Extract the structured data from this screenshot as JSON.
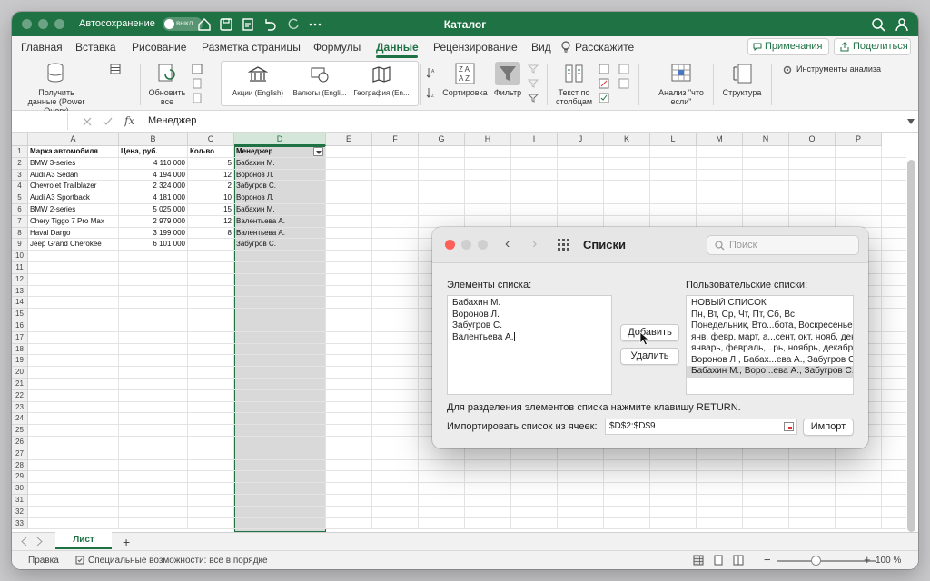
{
  "titlebar": {
    "autosave_label": "Автосохранение",
    "autosave_state": "выкл.",
    "document_title": "Каталог"
  },
  "ribbon_tabs": {
    "items": [
      "Главная",
      "Вставка",
      "Рисование",
      "Разметка страницы",
      "Формулы",
      "Данные",
      "Рецензирование",
      "Вид"
    ],
    "active": "Данные",
    "tell_me": "Расскажите",
    "notes_button": "Примечания",
    "share_button": "Поделиться"
  },
  "ribbon": {
    "get_data": [
      "Получить",
      "данные (Power Query)"
    ],
    "refresh_all": [
      "Обновить",
      "все"
    ],
    "data_types": [
      "Акции (English)",
      "Валюты (Engli...",
      "География (En..."
    ],
    "sort": "Сортировка",
    "filter": "Фильтр",
    "text_to_columns": [
      "Текст по",
      "столбцам"
    ],
    "what_if": [
      "Анализ \"что",
      "если\""
    ],
    "outline": "Структура",
    "analysis_tools": "Инструменты анализа"
  },
  "formula_bar": {
    "fx": "fx",
    "content": "Менеджер"
  },
  "sheet": {
    "columns": [
      "A",
      "B",
      "C",
      "D",
      "E",
      "F",
      "G",
      "H",
      "I",
      "J",
      "K",
      "L",
      "M",
      "N",
      "O",
      "P"
    ],
    "selected_column": "D",
    "row_count": 33,
    "headers": [
      "Марка автомобиля",
      "Цена, руб.",
      "Кол-во",
      "Менеджер"
    ],
    "rows": [
      [
        "BMW 3-series",
        "4 110 000",
        "5",
        "Бабахин М."
      ],
      [
        "Audi A3 Sedan",
        "4 194 000",
        "12",
        "Воронов Л."
      ],
      [
        "Chevrolet Trailblazer",
        "2 324 000",
        "2",
        "Забугров С."
      ],
      [
        "Audi A3 Sportback",
        "4 181 000",
        "10",
        "Воронов Л."
      ],
      [
        "BMW 2-series",
        "5 025 000",
        "15",
        "Бабахин М."
      ],
      [
        "Chery Tiggo 7 Pro Max",
        "2 979 000",
        "12",
        "Валентьева А."
      ],
      [
        "Haval Dargo",
        "3 199 000",
        "8",
        "Валентьева А."
      ],
      [
        "Jeep Grand Cherokee",
        "6 101 000",
        "",
        "Забугров С."
      ]
    ]
  },
  "sheet_tabs": {
    "active": "Лист",
    "add": "+"
  },
  "statusbar": {
    "ready": "Правка",
    "accessibility": "Специальные возможности: все в порядке",
    "zoom": "100 %"
  },
  "dialog": {
    "title": "Списки",
    "search_placeholder": "Поиск",
    "entries_label": "Элементы списка:",
    "entries": [
      "Бабахин М.",
      "Воронов Л.",
      "Забугров С.",
      "Валентьева А."
    ],
    "custom_lists_label": "Пользовательские списки:",
    "custom_lists": [
      "НОВЫЙ СПИСОК",
      "Пн, Вт, Ср, Чт, Пт, Сб, Вс",
      "Понедельник, Вто...бота, Воскресенье",
      "янв, февр, март, а...сент, окт, нояб, дек",
      "январь, февраль,...рь, ноябрь, декабрь",
      "Воронов Л., Бабах...ева А., Забугров С.",
      "Бабахин М., Воро...ева А., Забугров С."
    ],
    "selected_index": 6,
    "add_button": "Добавить",
    "delete_button": "Удалить",
    "hint": "Для разделения элементов списка нажмите клавишу RETURN.",
    "import_label": "Импортировать список из ячеек:",
    "import_range": "$D$2:$D$9",
    "import_button": "Импорт"
  }
}
